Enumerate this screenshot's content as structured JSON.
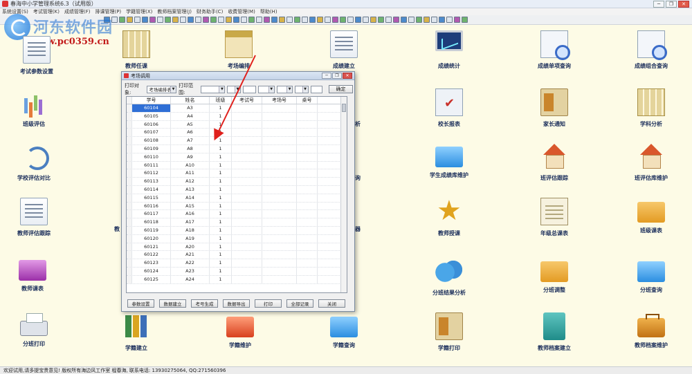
{
  "window": {
    "title": "春海中小学管理系统6.3（试用版）",
    "controls": [
      "─",
      "❐",
      "✕"
    ]
  },
  "watermark": {
    "title": "河东软件园",
    "url": "www.pc0359.cn"
  },
  "menu": [
    "系统设置(S)",
    "考试管理(K)",
    "成绩管理(F)",
    "排课管理(P)",
    "学籍管理(X)",
    "教师档案管理(J)",
    "财务助手(C)",
    "收费管理(M)",
    "帮助(H)"
  ],
  "icons": {
    "r1": [
      "考试参数设置",
      "教师任课",
      "考场编排",
      "成绩建立",
      "成绩统计",
      "成绩单项查询",
      "成绩组合查询"
    ],
    "r2": [
      "班级评估",
      "析",
      "校长报表",
      "家长通知",
      "学科分析"
    ],
    "r3": [
      "学校评估对比",
      "询",
      "学生成绩库维护",
      "班评估跟踪",
      "班评估库维护"
    ],
    "r4": [
      "教师评估跟踪",
      "教",
      "器",
      "教师授课",
      "年级总课表",
      "班级课表"
    ],
    "r5": [
      "教师课表",
      "分班结果分析",
      "分班调整",
      "分班查询"
    ],
    "r6": [
      "分班打印",
      "学籍建立",
      "学籍维护",
      "学籍查询",
      "学籍打印",
      "教师档案建立",
      "教师档案维护"
    ]
  },
  "dialog": {
    "title": "考场调用",
    "print_target_label": "打印对象:",
    "print_target_value": "考场编排表",
    "print_range_label": "打印范围:",
    "ok_label": "确定",
    "columns": [
      "学号",
      "姓名",
      "班级",
      "考试号",
      "考场号",
      "桌号"
    ],
    "rows": [
      [
        "60104",
        "A3",
        "1"
      ],
      [
        "60105",
        "A4",
        "1"
      ],
      [
        "60106",
        "A5",
        "1"
      ],
      [
        "60107",
        "A6",
        "1"
      ],
      [
        "60108",
        "A7",
        "1"
      ],
      [
        "60109",
        "A8",
        "1"
      ],
      [
        "60110",
        "A9",
        "1"
      ],
      [
        "60111",
        "A10",
        "1"
      ],
      [
        "60112",
        "A11",
        "1"
      ],
      [
        "60113",
        "A12",
        "1"
      ],
      [
        "60114",
        "A13",
        "1"
      ],
      [
        "60115",
        "A14",
        "1"
      ],
      [
        "60116",
        "A15",
        "1"
      ],
      [
        "60117",
        "A16",
        "1"
      ],
      [
        "60118",
        "A17",
        "1"
      ],
      [
        "60119",
        "A18",
        "1"
      ],
      [
        "60120",
        "A19",
        "1"
      ],
      [
        "60121",
        "A20",
        "1"
      ],
      [
        "60122",
        "A21",
        "1"
      ],
      [
        "60123",
        "A22",
        "1"
      ],
      [
        "60124",
        "A23",
        "1"
      ],
      [
        "60125",
        "A24",
        "1"
      ]
    ],
    "buttons": [
      "参数设置",
      "数据建立",
      "考号生成",
      "数据导出",
      "打印",
      "全部记录",
      "关闭"
    ]
  },
  "status": {
    "text": "欢迎试用,请多提宝贵意见! 版权所有海边风工作室 程春海, 联系电话: 13930275064, QQ:271560396"
  },
  "colors": {
    "desktop_bg": "#fdfbe6",
    "label_color": "#1a2d5a",
    "selection": "#2f6fd6",
    "arrow": "#e0201c"
  }
}
